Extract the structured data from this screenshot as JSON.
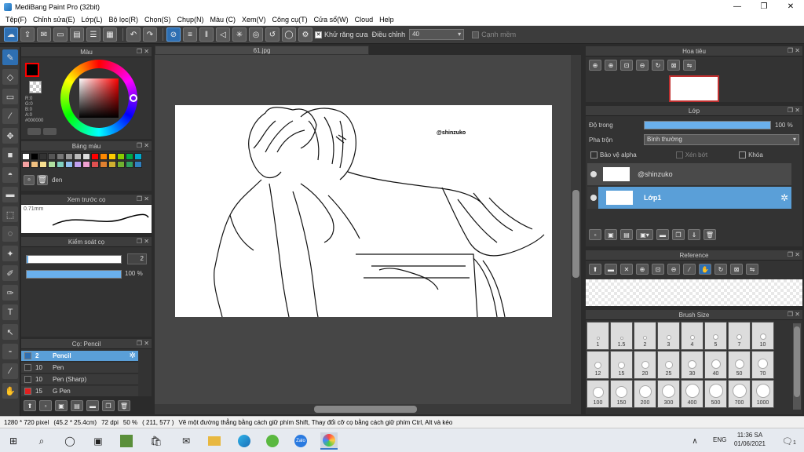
{
  "window": {
    "title": "MediBang Paint Pro (32bit)",
    "minimize": "—",
    "restore": "❐",
    "close": "✕"
  },
  "menu": [
    "Tệp(F)",
    "Chỉnh sửa(E)",
    "Lớp(L)",
    "Bộ lọc(R)",
    "Chọn(S)",
    "Chụp(N)",
    "Màu (C)",
    "Xem(V)",
    "Công cụ(T)",
    "Cửa sổ(W)",
    "Cloud",
    "Help"
  ],
  "toolbar": {
    "antialias_label": "Khử răng cưa",
    "antialias_checked": "✕",
    "correction_label": "Điều chỉnh",
    "correction_value": "40",
    "snap_label": "Cạnh mềm"
  },
  "color_panel": {
    "title": "Màu",
    "r": "R:0",
    "g": "G:0",
    "b": "B:0",
    "a": "A:0",
    "hex": "#000000",
    "primary_color": "#000000",
    "accent": "#ff0000"
  },
  "palette_panel": {
    "title": "Bảng màu",
    "color_name": "đen",
    "swatches": [
      "#ffffff",
      "#000000",
      "#333333",
      "#555555",
      "#777777",
      "#999999",
      "#bbbbbb",
      "#dddddd",
      "#ff0000",
      "#ff8800",
      "#ffcc00",
      "#88cc00",
      "#00aa44",
      "#00aacc",
      "#f4a0a0",
      "#f0c080",
      "#f8e090",
      "#b0e0a0",
      "#80d0c0",
      "#90c0f0",
      "#c0a0f0",
      "#f0a0d0",
      "#e05050",
      "#e08030",
      "#d0b030",
      "#70b030",
      "#30a060",
      "#3080c0"
    ]
  },
  "preview_panel": {
    "title": "Xem trước cọ",
    "size": "0.71mm"
  },
  "brush_control": {
    "title": "Kiểm soát cọ",
    "size_value": "2",
    "opacity_value": "100 %",
    "opacity_fraction": 1.0
  },
  "brush_list": {
    "title": "Cọ: Pencil",
    "items": [
      {
        "num": "2",
        "name": "Pencil",
        "color": "#2e6fb2"
      },
      {
        "num": "10",
        "name": "Pen",
        "color": "#333333"
      },
      {
        "num": "10",
        "name": "Pen (Sharp)",
        "color": "#333333"
      },
      {
        "num": "15",
        "name": "G Pen",
        "color": "#e02020"
      }
    ]
  },
  "document": {
    "tab_name": "61.jpg",
    "watermark": "@shinzuko"
  },
  "navigator_panel": {
    "title": "Hoa tiêu"
  },
  "layer_panel": {
    "title": "Lớp",
    "opacity_label": "Độ trong",
    "opacity_value": "100 %",
    "opacity_fraction": 1.0,
    "blend_label": "Pha trộn",
    "blend_value": "Bình thường",
    "protect_alpha": "Bảo vệ alpha",
    "clipping": "Xén bớt",
    "lock": "Khóa",
    "layers": [
      {
        "name": "@shinzuko",
        "selected": false
      },
      {
        "name": "Lớp1",
        "selected": true
      }
    ]
  },
  "reference_panel": {
    "title": "Reference"
  },
  "brush_size_panel": {
    "title": "Brush Size",
    "sizes": [
      "1",
      "1.5",
      "2",
      "3",
      "4",
      "5",
      "7",
      "10",
      "12",
      "15",
      "20",
      "25",
      "30",
      "40",
      "50",
      "70",
      "100",
      "150",
      "200",
      "300",
      "400",
      "500",
      "700",
      "1000"
    ]
  },
  "status": {
    "dimensions": "1280 * 720 pixel",
    "physical": "(45.2 * 25.4cm)",
    "dpi": "72 dpi",
    "zoom": "50 %",
    "cursor": "( 211, 577 )",
    "hint": "Vẽ một đường thẳng bằng cách giữ phím Shift, Thay đổi cỡ cọ bằng cách giữ phím Ctrl, Alt và kéo"
  },
  "taskbar": {
    "lang": "ENG",
    "time": "11:36 SA",
    "date": "01/06/2021",
    "notif_count": "1"
  }
}
